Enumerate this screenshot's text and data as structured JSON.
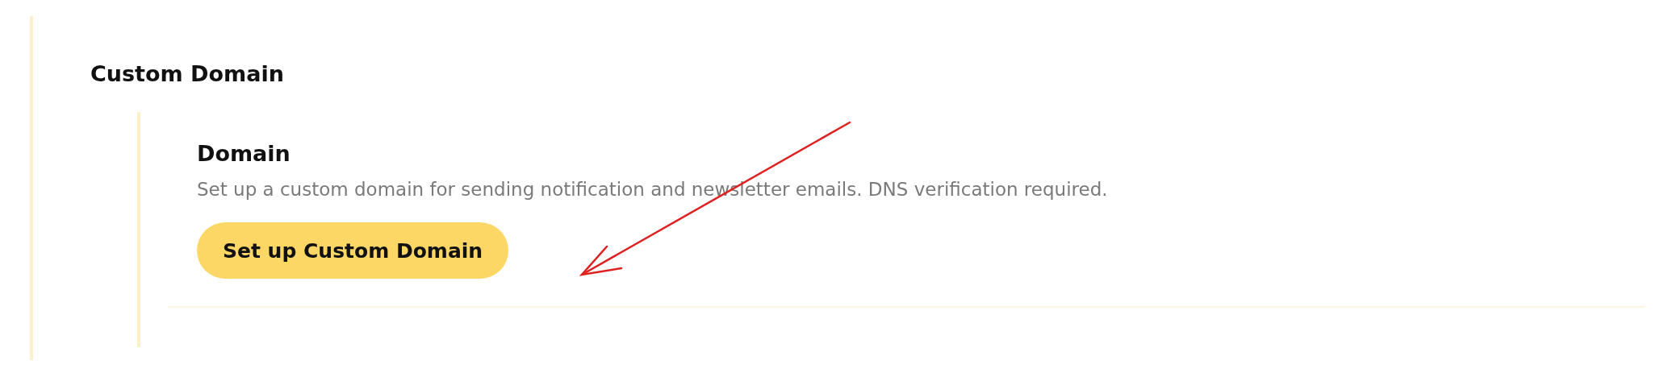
{
  "section": {
    "title": "Custom Domain"
  },
  "setting": {
    "title": "Domain",
    "description": "Set up a custom domain for sending notification and newsletter emails. DNS verification required.",
    "button": "Set up Custom Domain"
  }
}
